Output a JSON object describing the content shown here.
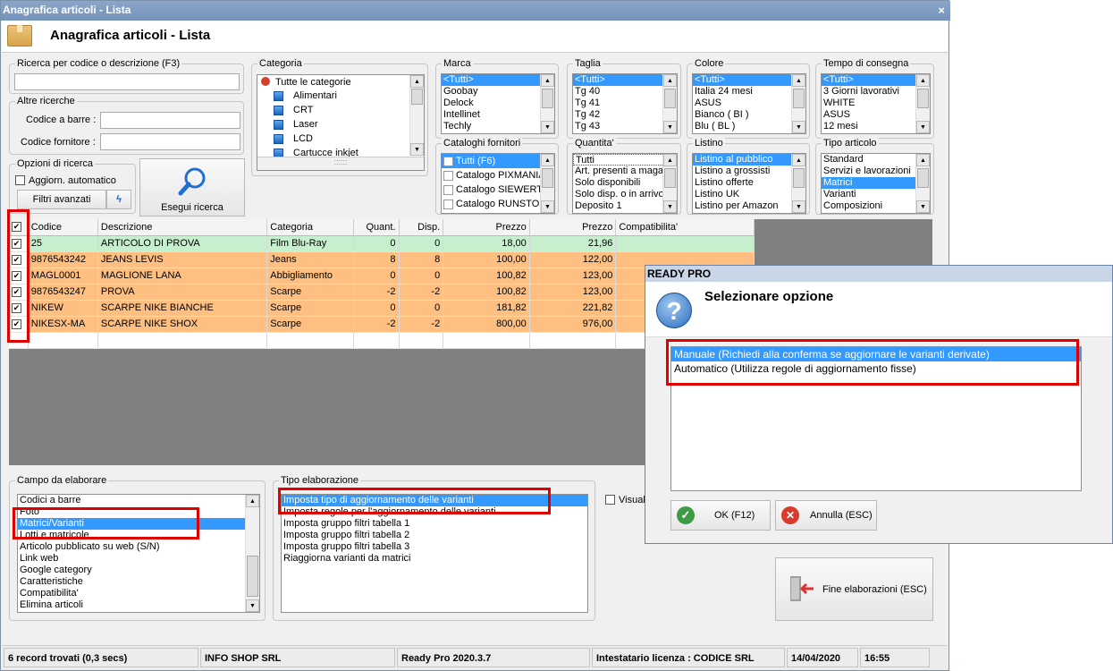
{
  "window": {
    "title": "Anagrafica articoli  - Lista",
    "close": "×"
  },
  "header": {
    "title": "Anagrafica articoli  - Lista"
  },
  "search": {
    "legend": "Ricerca per codice o descrizione (F3)",
    "value": ""
  },
  "other": {
    "legend": "Altre ricerche",
    "barcode_label": "Codice a barre :",
    "supplier_label": "Codice fornitore :"
  },
  "options": {
    "legend": "Opzioni di ricerca",
    "auto_label": "Aggiorn. automatico",
    "filters_label": "Filtri avanzati",
    "bolt": "ϟ"
  },
  "run": {
    "label": "Esegui ricerca"
  },
  "categoria": {
    "legend": "Categoria",
    "root": "Tutte le categorie",
    "items": [
      "Alimentari",
      "CRT",
      "Laser",
      "LCD",
      "Cartucce inkjet"
    ],
    "hscroll": "::::::"
  },
  "marca": {
    "legend": "Marca",
    "items": [
      "<Tutti>",
      "Goobay",
      "Delock",
      "Intellinet",
      "Techly"
    ]
  },
  "taglia": {
    "legend": "Taglia",
    "items": [
      "<Tutti>",
      "Tg 40",
      "Tg 41",
      "Tg 42",
      "Tg 43"
    ]
  },
  "colore": {
    "legend": "Colore",
    "items": [
      "<Tutti>",
      "Italia 24 mesi",
      "ASUS",
      "Bianco ( BI )",
      "Blu ( BL )"
    ]
  },
  "tempo": {
    "legend": "Tempo di consegna",
    "items": [
      "<Tutti>",
      "3 Giorni lavorativi",
      "WHITE",
      "ASUS",
      "12 mesi"
    ]
  },
  "cataloghi": {
    "legend": "Cataloghi fornitori",
    "items": [
      "Tutti (F6)",
      "Catalogo PIXMANIA",
      "Catalogo SIEWERT",
      "Catalogo RUNSTORE"
    ]
  },
  "quantita": {
    "legend": "Quantita'",
    "items": [
      "Tutti",
      "Art. presenti a magazzino",
      "Solo disponibili",
      "Solo disp. o in arrivo",
      "Deposito 1"
    ]
  },
  "listino": {
    "legend": "Listino",
    "items": [
      "Listino al pubblico",
      "Listino a grossisti",
      "Listino offerte",
      "Listino UK",
      "Listino per Amazon"
    ]
  },
  "tipo": {
    "legend": "Tipo articolo",
    "items": [
      "Standard",
      "Servizi e lavorazioni",
      "Matrici",
      "Varianti",
      "Composizioni"
    ]
  },
  "grid": {
    "headers": [
      "Codice",
      "Descrizione",
      "Categoria",
      "Quant.",
      "Disp.",
      "Prezzo",
      "Prezzo",
      "Compatibilita'"
    ],
    "rows": [
      {
        "codice": "25",
        "descrizione": "ARTICOLO DI PROVA",
        "categoria": "Film Blu-Ray",
        "quant": "0",
        "disp": "0",
        "prezzo1": "18,00",
        "prezzo2": "21,96",
        "compat": "",
        "color": "#c6efce"
      },
      {
        "codice": "9876543242",
        "descrizione": "JEANS LEVIS",
        "categoria": "Jeans",
        "quant": "8",
        "disp": "8",
        "prezzo1": "100,00",
        "prezzo2": "122,00",
        "compat": "",
        "color": "#ffbf80"
      },
      {
        "codice": "MAGL0001",
        "descrizione": "MAGLIONE LANA",
        "categoria": "Abbigliamento",
        "quant": "0",
        "disp": "0",
        "prezzo1": "100,82",
        "prezzo2": "123,00",
        "compat": "",
        "color": "#ffbf80"
      },
      {
        "codice": "9876543247",
        "descrizione": "PROVA",
        "categoria": "Scarpe",
        "quant": "-2",
        "disp": "-2",
        "prezzo1": "100,82",
        "prezzo2": "123,00",
        "compat": "",
        "color": "#ffbf80"
      },
      {
        "codice": "NIKEW",
        "descrizione": "SCARPE NIKE BIANCHE",
        "categoria": "Scarpe",
        "quant": "0",
        "disp": "0",
        "prezzo1": "181,82",
        "prezzo2": "221,82",
        "compat": "",
        "color": "#ffbf80"
      },
      {
        "codice": "NIKESX-MA",
        "descrizione": "SCARPE NIKE SHOX",
        "categoria": "Scarpe",
        "quant": "-2",
        "disp": "-2",
        "prezzo1": "800,00",
        "prezzo2": "976,00",
        "compat": "",
        "color": "#ffbf80"
      }
    ]
  },
  "campo": {
    "legend": "Campo da elaborare",
    "items": [
      "Codici a barre",
      "Foto",
      "Matrici/Varianti",
      "Lotti e matricole",
      "Articolo pubblicato su web (S/N)",
      "Link web",
      "Google category",
      "Caratteristiche",
      "Compatibilita'",
      "Elimina articoli"
    ],
    "selected": "Matrici/Varianti"
  },
  "tipo_elab": {
    "legend": "Tipo elaborazione",
    "items": [
      "Imposta tipo di aggiornamento delle varianti",
      "Imposta regole per l'aggiornamento delle varianti",
      "Imposta gruppo filtri tabella 1",
      "Imposta gruppo filtri tabella 2",
      "Imposta gruppo filtri tabella 3",
      "Riaggiorna varianti da matrici"
    ]
  },
  "visual_label": "Visuali",
  "fine": {
    "label": "Fine elaborazioni (ESC)"
  },
  "status": {
    "records": "6 record trovati (0,3 secs)",
    "company": "INFO SHOP SRL",
    "version": "Ready Pro 2020.3.7",
    "license": "Intestatario licenza : CODICE SRL",
    "date": "14/04/2020",
    "time": "16:55"
  },
  "dialog": {
    "title": "READY PRO",
    "heading": "Selezionare opzione",
    "options": [
      "Manuale (Richiedi alla conferma se aggiornare le varianti derivate)",
      "Automatico (Utilizza regole di aggiornamento fisse)"
    ],
    "ok": "OK (F12)",
    "cancel": "Annulla (ESC)",
    "check": "✓",
    "x": "✕",
    "q": "?"
  },
  "colors": {
    "selection": "#3399ff",
    "highlight": "#e00000",
    "row_green": "#c6efce",
    "row_orange": "#ffbf80"
  }
}
